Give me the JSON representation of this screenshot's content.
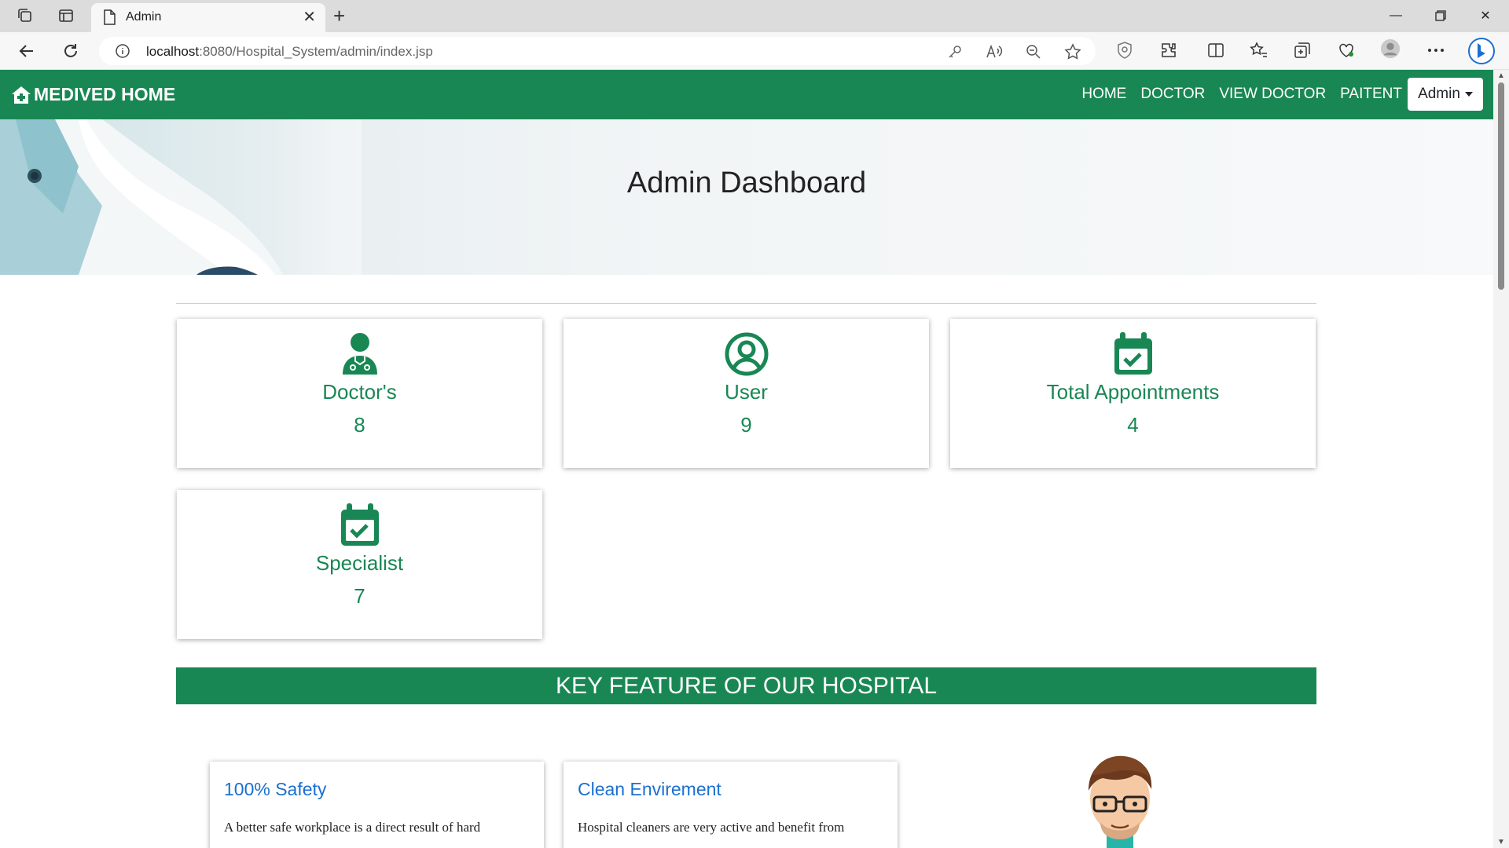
{
  "browser": {
    "tab_title": "Admin",
    "url_host": "localhost",
    "url_rest": ":8080/Hospital_System/admin/index.jsp"
  },
  "navbar": {
    "brand": "MEDIVED HOME",
    "links": [
      "HOME",
      "DOCTOR",
      "VIEW DOCTOR",
      "PAITENT"
    ],
    "admin_label": "Admin"
  },
  "hero": {
    "title": "Admin Dashboard"
  },
  "stats": [
    {
      "label": "Doctor's",
      "value": "8",
      "icon": "doctor-icon"
    },
    {
      "label": "User",
      "value": "9",
      "icon": "user-circle-icon"
    },
    {
      "label": "Total Appointments",
      "value": "4",
      "icon": "calendar-check-icon"
    },
    {
      "label": "Specialist",
      "value": "7",
      "icon": "calendar-check-icon"
    }
  ],
  "features": {
    "heading": "KEY FEATURE OF OUR HOSPITAL",
    "cards": [
      {
        "title": "100% Safety",
        "body": "A better safe workplace is a direct result of hard"
      },
      {
        "title": "Clean Envirement",
        "body": "Hospital cleaners are very active and benefit from"
      }
    ]
  },
  "colors": {
    "brand_green": "#198754",
    "link_blue": "#1a6fd1"
  }
}
